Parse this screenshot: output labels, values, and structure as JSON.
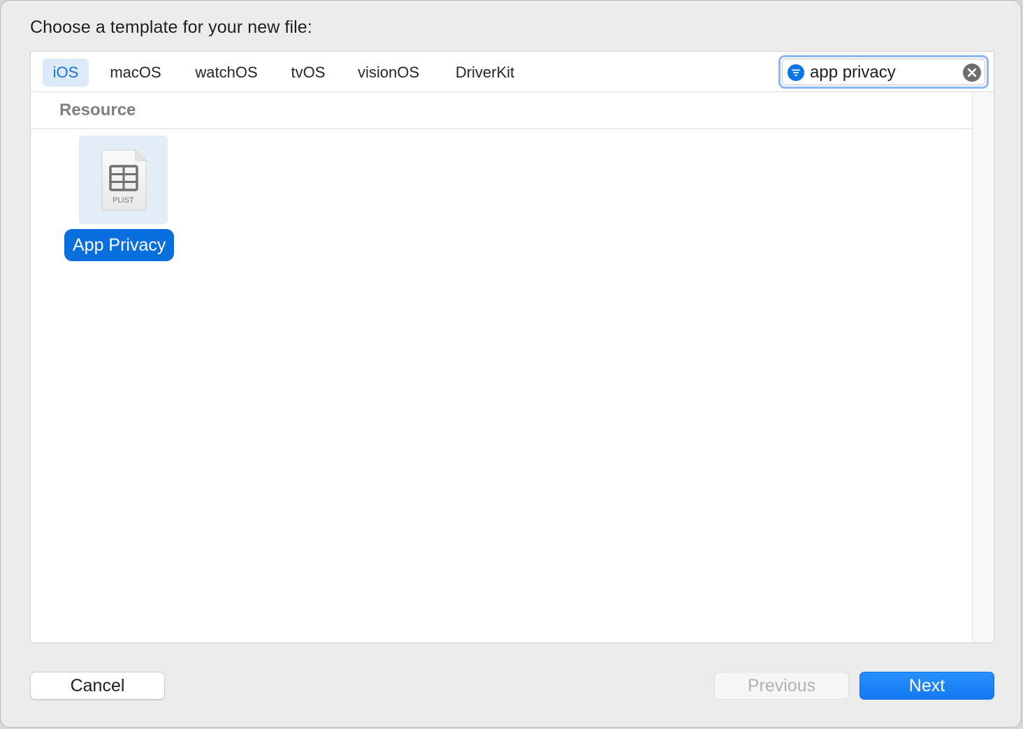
{
  "dialog": {
    "title": "Choose a template for your new file:"
  },
  "platform_tabs": [
    {
      "label": "iOS",
      "selected": true
    },
    {
      "label": "macOS",
      "selected": false
    },
    {
      "label": "watchOS",
      "selected": false
    },
    {
      "label": "tvOS",
      "selected": false
    },
    {
      "label": "visionOS",
      "selected": false
    },
    {
      "label": "DriverKit",
      "selected": false
    }
  ],
  "search": {
    "value": "app privacy",
    "icons": {
      "filter": "filter-icon",
      "clear": "clear-icon"
    },
    "accent_color": "#0a6fde"
  },
  "section": {
    "title": "Resource"
  },
  "templates": [
    {
      "label": "App Privacy",
      "icon": "plist-file-icon",
      "icon_caption": "PLIST",
      "selected": true
    }
  ],
  "buttons": {
    "cancel": "Cancel",
    "previous": "Previous",
    "previous_disabled": true,
    "next": "Next"
  },
  "colors": {
    "selection": "#0a6fde",
    "tab_selected_bg": "#dbe9f8",
    "primary_button": "#1479f2"
  }
}
